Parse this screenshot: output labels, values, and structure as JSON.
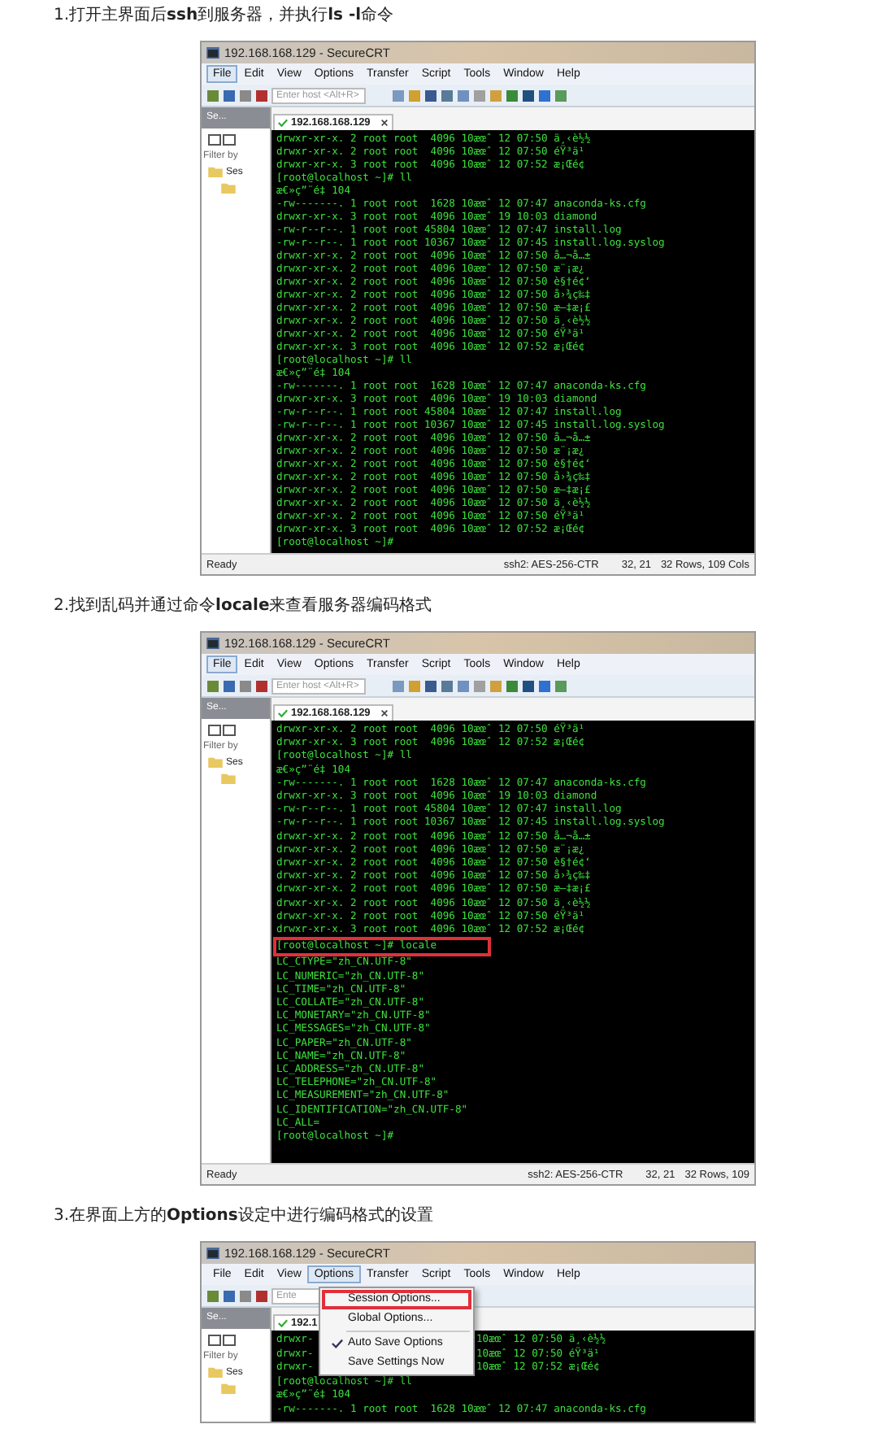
{
  "sections": [
    {
      "heading": "1.打开主界面后**ssh**到服务器，并执行**ls -l**命令",
      "screenshot": {
        "window_title": "192.168.168.129 - SecureCRT",
        "menu": [
          {
            "label": "File",
            "selected": true
          },
          {
            "label": "Edit",
            "selected": false
          },
          {
            "label": "View",
            "selected": false
          },
          {
            "label": "Options",
            "selected": false
          },
          {
            "label": "Transfer",
            "selected": false
          },
          {
            "label": "Script",
            "selected": false
          },
          {
            "label": "Tools",
            "selected": false
          },
          {
            "label": "Window",
            "selected": false
          },
          {
            "label": "Help",
            "selected": false
          }
        ],
        "host_placeholder": "Enter host <Alt+R>",
        "sidebar": {
          "header": "Se...",
          "filter": "Filter by",
          "tree_root": "Ses"
        },
        "tab_label": "192.168.168.129",
        "terminal_lines": [
          {
            "text": "drwxr-xr-x. 2 root root  4096 10æœˆ 12 07:50 ä¸‹è½½",
            "highlighted": false
          },
          {
            "text": "drwxr-xr-x. 2 root root  4096 10æœˆ 12 07:50 éŸ³ä¹",
            "highlighted": false
          },
          {
            "text": "drwxr-xr-x. 3 root root  4096 10æœˆ 12 07:52 æ¡Œé¢",
            "highlighted": false
          },
          {
            "text": "[root@localhost ~]# ll",
            "highlighted": false
          },
          {
            "text": "æ€»ç”¨é‡ 104",
            "highlighted": false
          },
          {
            "text": "-rw-------. 1 root root  1628 10æœˆ 12 07:47 anaconda-ks.cfg",
            "highlighted": false
          },
          {
            "text": "drwxr-xr-x. 3 root root  4096 10æœˆ 19 10:03 diamond",
            "highlighted": false
          },
          {
            "text": "-rw-r--r--. 1 root root 45804 10æœˆ 12 07:47 install.log",
            "highlighted": false
          },
          {
            "text": "-rw-r--r--. 1 root root 10367 10æœˆ 12 07:45 install.log.syslog",
            "highlighted": false
          },
          {
            "text": "drwxr-xr-x. 2 root root  4096 10æœˆ 12 07:50 å…¬å…±",
            "highlighted": false
          },
          {
            "text": "drwxr-xr-x. 2 root root  4096 10æœˆ 12 07:50 æ¨¡æ¿",
            "highlighted": false
          },
          {
            "text": "drwxr-xr-x. 2 root root  4096 10æœˆ 12 07:50 è§†é¢‘",
            "highlighted": false
          },
          {
            "text": "drwxr-xr-x. 2 root root  4096 10æœˆ 12 07:50 å›¾ç‰‡",
            "highlighted": false
          },
          {
            "text": "drwxr-xr-x. 2 root root  4096 10æœˆ 12 07:50 æ–‡æ¡£",
            "highlighted": false
          },
          {
            "text": "drwxr-xr-x. 2 root root  4096 10æœˆ 12 07:50 ä¸‹è½½",
            "highlighted": false
          },
          {
            "text": "drwxr-xr-x. 2 root root  4096 10æœˆ 12 07:50 éŸ³ä¹",
            "highlighted": false
          },
          {
            "text": "drwxr-xr-x. 3 root root  4096 10æœˆ 12 07:52 æ¡Œé¢",
            "highlighted": false
          },
          {
            "text": "[root@localhost ~]# ll",
            "highlighted": false
          },
          {
            "text": "æ€»ç”¨é‡ 104",
            "highlighted": false
          },
          {
            "text": "-rw-------. 1 root root  1628 10æœˆ 12 07:47 anaconda-ks.cfg",
            "highlighted": false
          },
          {
            "text": "drwxr-xr-x. 3 root root  4096 10æœˆ 19 10:03 diamond",
            "highlighted": false
          },
          {
            "text": "-rw-r--r--. 1 root root 45804 10æœˆ 12 07:47 install.log",
            "highlighted": false
          },
          {
            "text": "-rw-r--r--. 1 root root 10367 10æœˆ 12 07:45 install.log.syslog",
            "highlighted": false
          },
          {
            "text": "drwxr-xr-x. 2 root root  4096 10æœˆ 12 07:50 å…¬å…±",
            "highlighted": false
          },
          {
            "text": "drwxr-xr-x. 2 root root  4096 10æœˆ 12 07:50 æ¨¡æ¿",
            "highlighted": false
          },
          {
            "text": "drwxr-xr-x. 2 root root  4096 10æœˆ 12 07:50 è§†é¢‘",
            "highlighted": false
          },
          {
            "text": "drwxr-xr-x. 2 root root  4096 10æœˆ 12 07:50 å›¾ç‰‡",
            "highlighted": false
          },
          {
            "text": "drwxr-xr-x. 2 root root  4096 10æœˆ 12 07:50 æ–‡æ¡£",
            "highlighted": false
          },
          {
            "text": "drwxr-xr-x. 2 root root  4096 10æœˆ 12 07:50 ä¸‹è½½",
            "highlighted": false
          },
          {
            "text": "drwxr-xr-x. 2 root root  4096 10æœˆ 12 07:50 éŸ³ä¹",
            "highlighted": false
          },
          {
            "text": "drwxr-xr-x. 3 root root  4096 10æœˆ 12 07:52 æ¡Œé¢",
            "highlighted": false
          },
          {
            "text": "[root@localhost ~]#",
            "highlighted": false
          }
        ],
        "status_bar": {
          "status": "Ready",
          "cipher": "ssh2: AES-256-CTR",
          "position": "32, 21",
          "size": "32 Rows, 109 Cols"
        }
      }
    },
    {
      "heading": "2.找到乱码并通过命令**locale**来查看服务器编码格式",
      "screenshot": {
        "window_title": "192.168.168.129 - SecureCRT",
        "menu": [
          {
            "label": "File",
            "selected": true
          },
          {
            "label": "Edit",
            "selected": false
          },
          {
            "label": "View",
            "selected": false
          },
          {
            "label": "Options",
            "selected": false
          },
          {
            "label": "Transfer",
            "selected": false
          },
          {
            "label": "Script",
            "selected": false
          },
          {
            "label": "Tools",
            "selected": false
          },
          {
            "label": "Window",
            "selected": false
          },
          {
            "label": "Help",
            "selected": false
          }
        ],
        "host_placeholder": "Enter host <Alt+R>",
        "sidebar": {
          "header": "Se...",
          "filter": "Filter by",
          "tree_root": "Ses"
        },
        "tab_label": "192.168.168.129",
        "terminal_lines": [
          {
            "text": "drwxr-xr-x. 2 root root  4096 10æœˆ 12 07:50 éŸ³ä¹",
            "highlighted": false
          },
          {
            "text": "drwxr-xr-x. 3 root root  4096 10æœˆ 12 07:52 æ¡Œé¢",
            "highlighted": false
          },
          {
            "text": "[root@localhost ~]# ll",
            "highlighted": false
          },
          {
            "text": "æ€»ç”¨é‡ 104",
            "highlighted": false
          },
          {
            "text": "-rw-------. 1 root root  1628 10æœˆ 12 07:47 anaconda-ks.cfg",
            "highlighted": false
          },
          {
            "text": "drwxr-xr-x. 3 root root  4096 10æœˆ 19 10:03 diamond",
            "highlighted": false
          },
          {
            "text": "-rw-r--r--. 1 root root 45804 10æœˆ 12 07:47 install.log",
            "highlighted": false
          },
          {
            "text": "-rw-r--r--. 1 root root 10367 10æœˆ 12 07:45 install.log.syslog",
            "highlighted": false
          },
          {
            "text": "drwxr-xr-x. 2 root root  4096 10æœˆ 12 07:50 å…¬å…±",
            "highlighted": false
          },
          {
            "text": "drwxr-xr-x. 2 root root  4096 10æœˆ 12 07:50 æ¨¡æ¿",
            "highlighted": false
          },
          {
            "text": "drwxr-xr-x. 2 root root  4096 10æœˆ 12 07:50 è§†é¢‘",
            "highlighted": false
          },
          {
            "text": "drwxr-xr-x. 2 root root  4096 10æœˆ 12 07:50 å›¾ç‰‡",
            "highlighted": false
          },
          {
            "text": "drwxr-xr-x. 2 root root  4096 10æœˆ 12 07:50 æ–‡æ¡£",
            "highlighted": false
          },
          {
            "text": "drwxr-xr-x. 2 root root  4096 10æœˆ 12 07:50 ä¸‹è½½",
            "highlighted": false
          },
          {
            "text": "drwxr-xr-x. 2 root root  4096 10æœˆ 12 07:50 éŸ³ä¹",
            "highlighted": false
          },
          {
            "text": "drwxr-xr-x. 3 root root  4096 10æœˆ 12 07:52 æ¡Œé¢",
            "highlighted": false
          },
          {
            "text": "[root@localhost ~]# locale",
            "highlighted": true
          },
          {
            "text": "LC_CTYPE=\"zh_CN.UTF-8\"",
            "highlighted": false
          },
          {
            "text": "LC_NUMERIC=\"zh_CN.UTF-8\"",
            "highlighted": false
          },
          {
            "text": "LC_TIME=\"zh_CN.UTF-8\"",
            "highlighted": false
          },
          {
            "text": "LC_COLLATE=\"zh_CN.UTF-8\"",
            "highlighted": false
          },
          {
            "text": "LC_MONETARY=\"zh_CN.UTF-8\"",
            "highlighted": false
          },
          {
            "text": "LC_MESSAGES=\"zh_CN.UTF-8\"",
            "highlighted": false
          },
          {
            "text": "LC_PAPER=\"zh_CN.UTF-8\"",
            "highlighted": false
          },
          {
            "text": "LC_NAME=\"zh_CN.UTF-8\"",
            "highlighted": false
          },
          {
            "text": "LC_ADDRESS=\"zh_CN.UTF-8\"",
            "highlighted": false
          },
          {
            "text": "LC_TELEPHONE=\"zh_CN.UTF-8\"",
            "highlighted": false
          },
          {
            "text": "LC_MEASUREMENT=\"zh_CN.UTF-8\"",
            "highlighted": false
          },
          {
            "text": "LC_IDENTIFICATION=\"zh_CN.UTF-8\"",
            "highlighted": false
          },
          {
            "text": "LC_ALL=",
            "highlighted": false
          },
          {
            "text": "[root@localhost ~]#",
            "highlighted": false
          }
        ],
        "status_bar": {
          "status": "Ready",
          "cipher": "ssh2: AES-256-CTR",
          "position": "32, 21",
          "size": "32 Rows, 109"
        }
      }
    },
    {
      "heading": "3.在界面上方的**Options**设定中进行编码格式的设置",
      "screenshot": {
        "window_title": "192.168.168.129 - SecureCRT",
        "menu": [
          {
            "label": "File",
            "selected": false
          },
          {
            "label": "Edit",
            "selected": false
          },
          {
            "label": "View",
            "selected": false
          },
          {
            "label": "Options",
            "selected": true
          },
          {
            "label": "Transfer",
            "selected": false
          },
          {
            "label": "Script",
            "selected": false
          },
          {
            "label": "Tools",
            "selected": false
          },
          {
            "label": "Window",
            "selected": false
          },
          {
            "label": "Help",
            "selected": false
          }
        ],
        "host_placeholder": "Ente",
        "sidebar": {
          "header": "Se...",
          "filter": "Filter by",
          "tree_root": "Ses"
        },
        "tab_label": "192.1",
        "dropdown": [
          {
            "kind": "item",
            "label": "Session Options...",
            "checked": false,
            "highlighted": true
          },
          {
            "kind": "item",
            "label": "Global Options...",
            "checked": false,
            "highlighted": false
          },
          {
            "kind": "separator"
          },
          {
            "kind": "item",
            "label": "Auto Save Options",
            "checked": true,
            "highlighted": false
          },
          {
            "kind": "item",
            "label": "Save Settings Now",
            "checked": false,
            "highlighted": false
          }
        ],
        "terminal_lines": [
          {
            "text": "drwxr-",
            "text_after": "10æœˆ 12 07:50 ä¸‹è½½",
            "highlighted": false
          },
          {
            "text": "drwxr-",
            "text_after": "10æœˆ 12 07:50 éŸ³ä¹",
            "highlighted": false
          },
          {
            "text": "drwxr-",
            "text_after": "10æœˆ 12 07:52 æ¡Œé¢",
            "highlighted": false
          },
          {
            "text": "[root@localhost ~]# ll",
            "highlighted": false
          },
          {
            "text": "æ€»ç”¨é‡ 104",
            "highlighted": false
          },
          {
            "text": "-rw-------. 1 root root  1628 10æœˆ 12 07:47 anaconda-ks.cfg",
            "highlighted": false
          }
        ]
      }
    }
  ]
}
